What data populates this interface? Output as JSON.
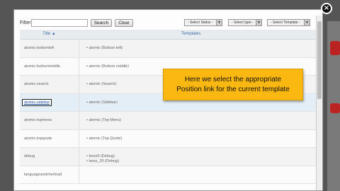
{
  "filter": {
    "label": "Filter:",
    "search_value": "",
    "search_label": "Search",
    "clear_label": "Clear",
    "select_status": "- Select Status -",
    "select_type": "- Select type -",
    "select_template": "- Select Template -"
  },
  "table": {
    "col_title": "Title ▲",
    "col_templates": "Templates",
    "rows": [
      {
        "title": "atomic-bottomleft",
        "templates": [
          "• atomic (Bottom left)"
        ]
      },
      {
        "title": "atomic-bottommiddle",
        "templates": [
          "• atomic (Bottom middle)"
        ]
      },
      {
        "title": "atomic-search",
        "templates": [
          "• atomic (Search)"
        ]
      },
      {
        "title": "atomic-sidebar",
        "templates": [
          "• atomic (Sidebar)"
        ]
      },
      {
        "title": "atomic-topmenu",
        "templates": [
          "• atomic (Top Menu)"
        ]
      },
      {
        "title": "atomic-topquote",
        "templates": [
          "• atomic (Top Quote)"
        ]
      },
      {
        "title": "debug",
        "templates": [
          "• beez5 (Debug)",
          "• beez_20 (Debug)"
        ]
      },
      {
        "title": "languageswitcherload",
        "templates": []
      }
    ]
  },
  "callout": {
    "line1": "Here we select the appropriate",
    "line2": "Position link for the current template"
  }
}
